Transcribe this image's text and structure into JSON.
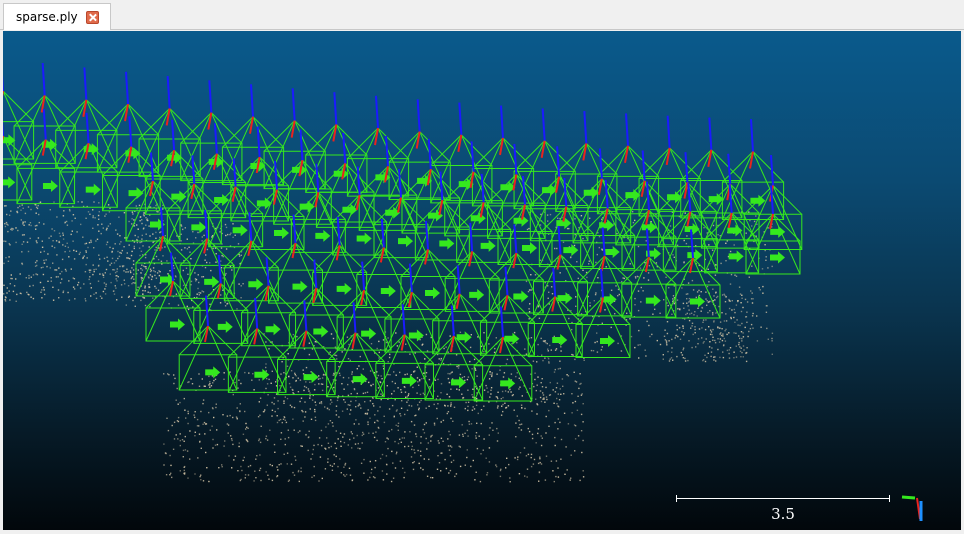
{
  "tabs": [
    {
      "label": "sparse.ply",
      "active": true
    }
  ],
  "scale_bar": {
    "label": "3.5"
  },
  "colors": {
    "camera_frustum": "#35e81e",
    "camera_up_axis": "#1a1aff",
    "camera_forward_axis": "#e8231e",
    "points": "#d8c8a8"
  }
}
